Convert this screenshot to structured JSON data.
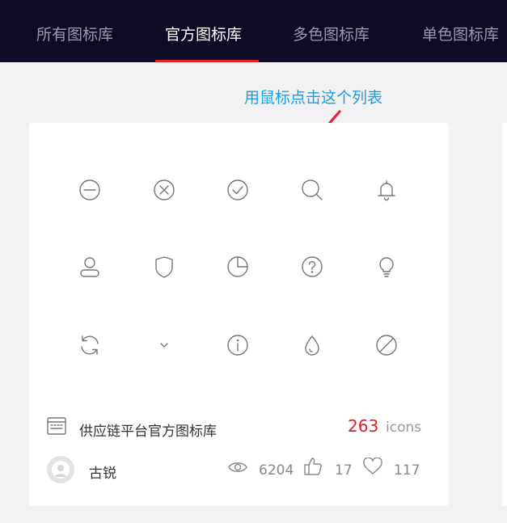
{
  "nav": {
    "tabs": [
      {
        "label": "所有图标库",
        "active": false
      },
      {
        "label": "官方图标库",
        "active": true
      },
      {
        "label": "多色图标库",
        "active": false
      },
      {
        "label": "单色图标库",
        "active": false
      }
    ]
  },
  "annotation": {
    "text": "用鼠标点击这个列表",
    "color": "#1a9ee0",
    "arrow_color": "#e8202a"
  },
  "card": {
    "icons": [
      "minus-circle-icon",
      "close-circle-icon",
      "check-circle-icon",
      "search-icon",
      "bell-icon",
      "user-icon",
      "shield-icon",
      "pie-chart-icon",
      "question-circle-icon",
      "bulb-icon",
      "sync-icon",
      "chevron-down-icon",
      "info-circle-icon",
      "drop-icon",
      "stop-icon"
    ],
    "library_name": "供应链平台官方图标库",
    "icon_count": "263",
    "icon_count_unit": "icons",
    "author": "古锐",
    "views": "6204",
    "likes": "17",
    "favorites": "117"
  },
  "colors": {
    "nav_bg": "#0f0a25",
    "accent_red": "#e8202a",
    "count_red": "#d6222f"
  }
}
